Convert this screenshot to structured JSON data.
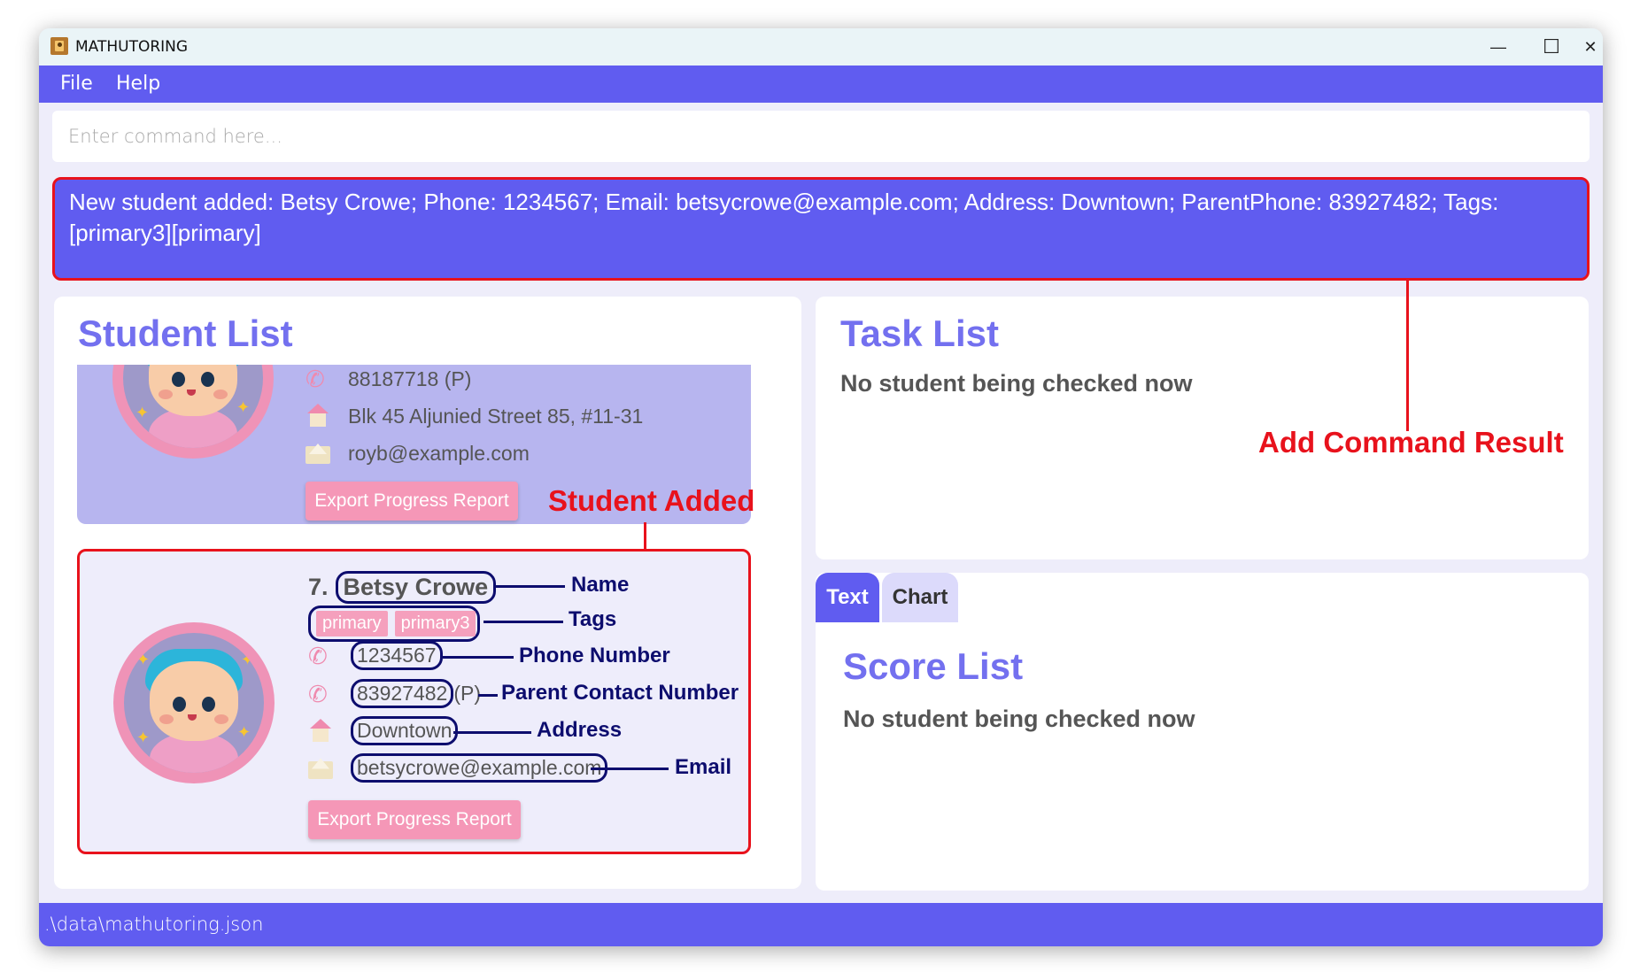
{
  "window": {
    "title": "MATHUTORING",
    "controls": {
      "minimize": "—",
      "maximize": "☐",
      "close": "✕"
    }
  },
  "menu": {
    "items": [
      {
        "label": "File"
      },
      {
        "label": "Help"
      }
    ]
  },
  "command_box": {
    "value": "",
    "placeholder": "Enter command here..."
  },
  "result_display": {
    "text": "New student added: Betsy Crowe; Phone: 1234567; Email: betsycrowe@example.com; Address: Downtown; ParentPhone: 83927482; Tags: [primary3][primary]"
  },
  "student_list": {
    "title": "Student List",
    "previous_card": {
      "parent_phone": "88187718 (P)",
      "address": "Blk 45 Aljunied Street 85, #11-31",
      "email": "royb@example.com",
      "export_label": "Export Progress Report"
    },
    "current_card": {
      "index": "7.",
      "name": "Betsy Crowe",
      "tags": [
        "primary",
        "primary3"
      ],
      "phone": "1234567",
      "parent_phone": "83927482",
      "parent_suffix": "(P)",
      "address": "Downtown",
      "email": "betsycrowe@example.com",
      "export_label": "Export Progress Report"
    }
  },
  "annotations": {
    "student_added": "Student Added",
    "add_command_result": "Add Command Result",
    "name": "Name",
    "tags": "Tags",
    "phone": "Phone Number",
    "parent_contact": "Parent Contact Number",
    "address": "Address",
    "email": "Email"
  },
  "task_list": {
    "title": "Task List",
    "message": "No student being checked now"
  },
  "score_panel": {
    "tabs": [
      {
        "label": "Text",
        "active": true
      },
      {
        "label": "Chart",
        "active": false
      }
    ],
    "title": "Score List",
    "message": "No student being checked now"
  },
  "status_bar": {
    "path": ".\\data\\mathutoring.json"
  },
  "colors": {
    "accent": "#605cf0",
    "annotation_red": "#e8121c",
    "annotation_navy": "#0d0d6e",
    "tag_pink": "#f5a0bd"
  }
}
